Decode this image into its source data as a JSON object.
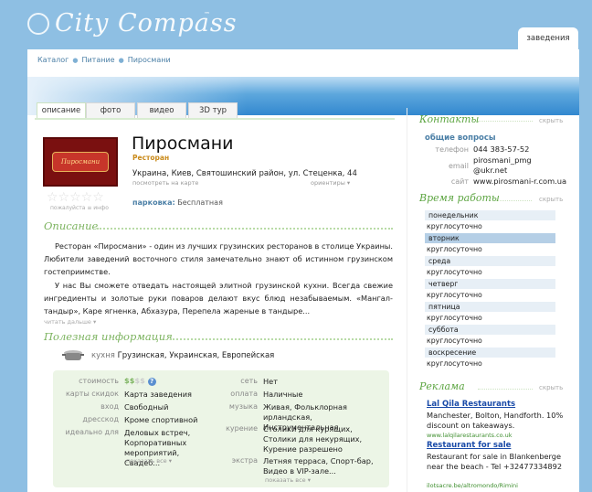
{
  "header": {
    "logo_text": "City Compass",
    "logo_tm": "™",
    "tab_label": "заведения"
  },
  "breadcrumb": [
    "Каталог",
    "Питание",
    "Пиросмани"
  ],
  "subtabs": [
    "описание",
    "фото",
    "видео",
    "3D тур"
  ],
  "venue": {
    "logo_text": "Пиросмани",
    "name": "Пиросмани",
    "category": "Ресторан",
    "address": "Украина, Киев, Святошинский район, ул. Стеценка, 44",
    "map_link": "посмотреть на карте",
    "orient_link": "ориентиры ▾",
    "rating": {
      "stars": "☆☆☆☆☆",
      "value_of_5": 0,
      "hint": "пожалуйста ≡ инфо"
    },
    "parking_label": "парковка:",
    "parking_value": "Бесплатная"
  },
  "description": {
    "heading": "Описание",
    "p1": "Ресторан «Пиросмани» - один из лучших грузинских ресторанов в столице Украины. Любители заведений восточного стиля замечательно знают об истинном грузинском гостеприимстве.",
    "p2": "У нас Вы сможете отведать настоящей элитной грузинской кухни. Всегда свежие ингредиенты и золотые руки поваров делают вкус блюд незабываемым. «Мангал-тандыр», Каре ягненка, Абхазура, Перепела жареные в тандыре...",
    "read_more": "читать дальше ▾"
  },
  "useful": {
    "heading": "Полезная информация",
    "cuisine_label": "кухня",
    "cuisine_value": "Грузинская, Украинская, Европейская",
    "cost_label": "стоимость",
    "cost_value": "$$",
    "cost_dim": "$$",
    "cost_help": "?",
    "left": [
      {
        "label": "карты скидок",
        "value": "Карта заведения"
      },
      {
        "label": "вход",
        "value": "Свободный"
      },
      {
        "label": "дресскод",
        "value": "Кроме спортивной"
      },
      {
        "label": "идеально для",
        "value": "Деловых встреч, Корпоративных мероприятий, Свадеб..."
      }
    ],
    "right": [
      {
        "label": "сеть",
        "value": "Нет"
      },
      {
        "label": "оплата",
        "value": "Наличные"
      },
      {
        "label": "музыка",
        "value": "Живая, Фольклорная ирландская, Инструментальная"
      },
      {
        "label": "курение",
        "value": "Столики для курящих, Столики для некурящих, Курение разрешено"
      },
      {
        "label": "экстра",
        "value": "Летняя терраса, Спорт-бар, Видео в VIP-зале..."
      }
    ],
    "show_all": "показать все ▾"
  },
  "contacts": {
    "heading": "Контакты",
    "hide": "скрыть",
    "general": "общие вопросы",
    "phone_label": "телефон",
    "phone": "044 383-57-52",
    "email_label": "email",
    "email": "pirosmani_pmg @ukr.net",
    "site_label": "сайт",
    "site": "www.pirosmani-r.com.ua"
  },
  "hours": {
    "heading": "Время работы",
    "hide": "скрыть",
    "days": [
      {
        "day": "понедельник",
        "time": "круглосуточно"
      },
      {
        "day": "вторник",
        "time": "круглосуточно"
      },
      {
        "day": "среда",
        "time": "круглосуточно"
      },
      {
        "day": "четверг",
        "time": "круглосуточно"
      },
      {
        "day": "пятница",
        "time": "круглосуточно"
      },
      {
        "day": "суббота",
        "time": "круглосуточно"
      },
      {
        "day": "воскресение",
        "time": "круглосуточно"
      }
    ]
  },
  "ads": {
    "heading": "Реклама",
    "hide": "скрыть",
    "items": [
      {
        "title": "Lal Qila Restaurants",
        "text": "Manchester, Bolton, Handforth. 10% discount on takeaways.",
        "url": "www.lalqilarestaurants.co.uk"
      },
      {
        "title": "Restaurant for sale",
        "text": "Restaurant for sale in Blankenberge near the beach - Tel +32477334892",
        "url": "ilotsacre.be/altromondo/Rimini"
      }
    ]
  },
  "colors": {
    "accent_green": "#7cb35f",
    "link_blue": "#4b7fa6",
    "banner_blue": "#3288cf",
    "sky": "#8ebfe3"
  }
}
